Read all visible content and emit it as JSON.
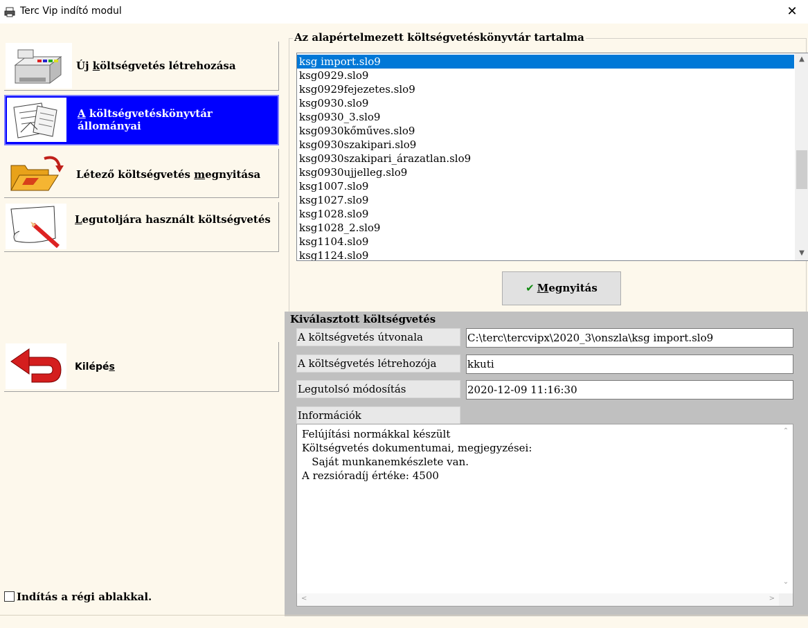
{
  "window": {
    "title": "Terc Vip indító modul",
    "close_glyph": "✕"
  },
  "menu": {
    "new_pre": "Új ",
    "new_u": "k",
    "new_post": "öltségvetés létrehozása",
    "files_u": "A",
    "files_post": " költségvetéskönyvtár állományai",
    "open_pre": "Létező költségvetés ",
    "open_u": "m",
    "open_post": "egnyitása",
    "last_u": "L",
    "last_post": "egutoljára használt költségvetés",
    "exit_pre": "Kilépé",
    "exit_u": "s"
  },
  "old_windows_label": "Indítás a régi ablakkal.",
  "library": {
    "title": "Az alapértelmezett költségvetéskönyvtár tartalma",
    "items": [
      "ksg import.slo9",
      "ksg0929.slo9",
      "ksg0929fejezetes.slo9",
      "ksg0930.slo9",
      "ksg0930_3.slo9",
      "ksg0930kőműves.slo9",
      "ksg0930szakipari.slo9",
      "ksg0930szakipari_árazatlan.slo9",
      "ksg0930ujjelleg.slo9",
      "ksg1007.slo9",
      "ksg1027.slo9",
      "ksg1028.slo9",
      "ksg1028_2.slo9",
      "ksg1104.slo9",
      "ksg1124.slo9"
    ],
    "selected_index": 0,
    "open_button_u": "M",
    "open_button_post": "egnyitás"
  },
  "selected": {
    "title": "Kiválasztott költségvetés",
    "path_label": "A költségvetés útvonala",
    "path_value": "C:\\terc\\tercvipx\\2020_3\\onszla\\ksg import.slo9",
    "creator_label": "A költségvetés létrehozója",
    "creator_value": "kkuti",
    "modified_label": "Legutolsó módosítás",
    "modified_value": "2020-12-09 11:16:30",
    "info_label": "Információk",
    "info_text": "Felújítási normákkal készült\nKöltségvetés dokumentumai, megjegyzései:\n   Saját munkanemkészlete van.\nA rezsióradíj értéke: 4500"
  },
  "icons": {
    "app": "printer-icon",
    "new": "cash-register-icon",
    "files": "documents-icon",
    "open": "open-folder-icon",
    "last": "pencil-paper-icon",
    "exit": "return-arrow-icon"
  },
  "colors": {
    "selected_menu_bg": "#0000ff",
    "list_selection": "#0078d7",
    "panel_gray": "#c0c0c0"
  }
}
